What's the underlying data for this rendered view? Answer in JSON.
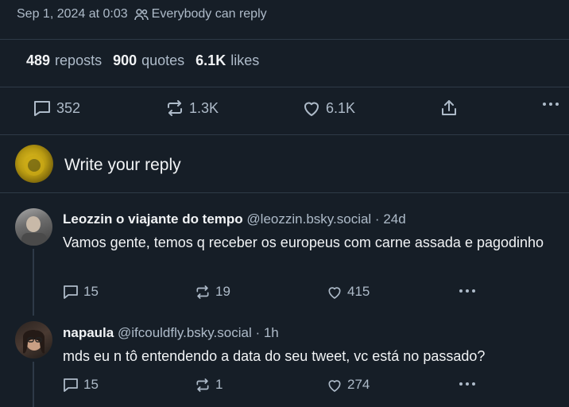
{
  "meta": {
    "timestamp": "Sep 1, 2024 at 0:03",
    "reply_permission": "Everybody can reply"
  },
  "stats": {
    "reposts_count": "489",
    "reposts_label": "reposts",
    "quotes_count": "900",
    "quotes_label": "quotes",
    "likes_count": "6.1K",
    "likes_label": "likes"
  },
  "actions": {
    "replies": "352",
    "reposts": "1.3K",
    "likes": "6.1K"
  },
  "reply_box": {
    "prompt": "Write your reply"
  },
  "replies": [
    {
      "name": "Leozzin o viajante do tempo",
      "handle": "@leozzin.bsky.social",
      "sep": " · ",
      "age": "24d",
      "text": "Vamos gente, temos q receber os europeus com carne assada e pagodinho",
      "reply_count": "15",
      "repost_count": "19",
      "like_count": "415"
    },
    {
      "name": "napaula",
      "handle": "@ifcouldfly.bsky.social",
      "sep": " · ",
      "age": "1h",
      "text": "mds eu n tô entendendo a data do seu tweet, vc está no passado?",
      "reply_count": "15",
      "repost_count": "1",
      "like_count": "274"
    }
  ],
  "colors": {
    "background": "#161e27",
    "muted_text": "#aebbc9",
    "divider": "#2e3a47"
  }
}
